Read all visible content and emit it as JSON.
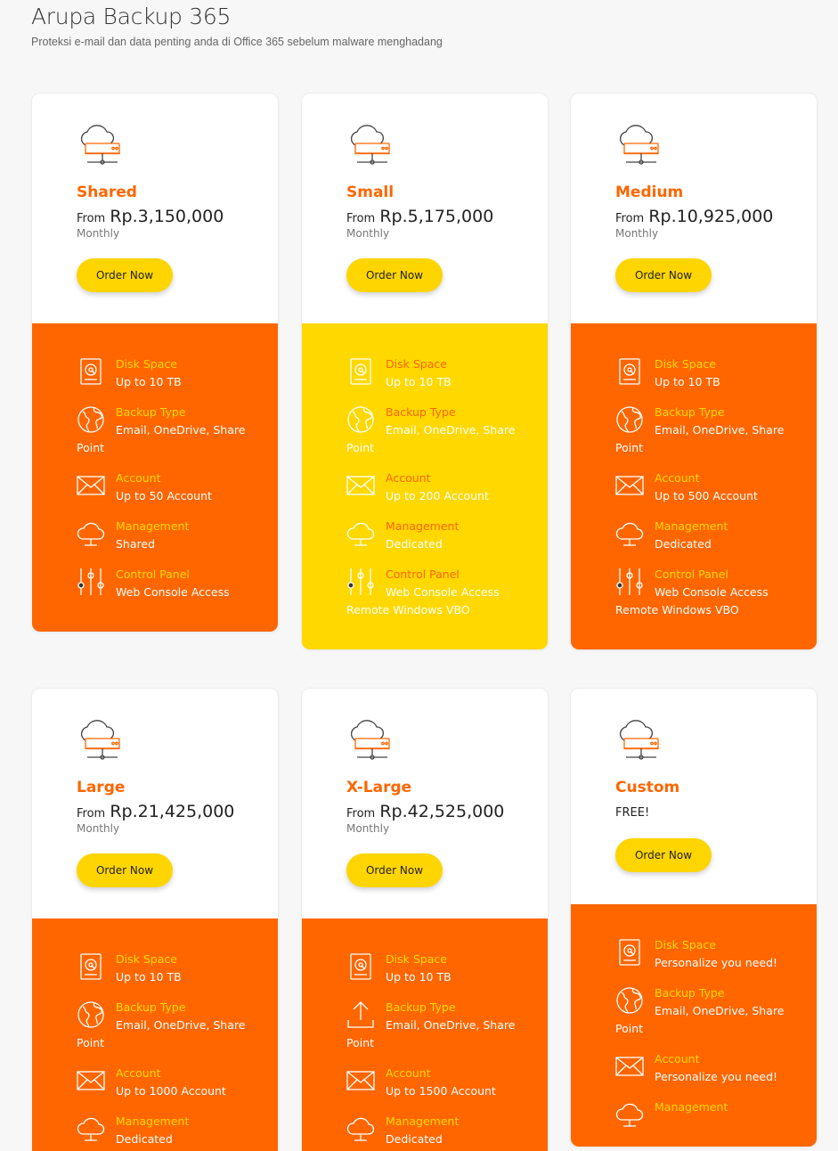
{
  "header": {
    "title": "Arupa Backup 365",
    "subtitle": "Proteksi e-mail dan data penting anda di Office 365 sebelum malware menghadang"
  },
  "colors": {
    "accent": "#ff6600",
    "highlight": "#ffd800",
    "button": "#ffd500"
  },
  "plans": [
    {
      "name": "Shared",
      "from": "From",
      "price": "Rp.3,150,000",
      "period": "Monthly",
      "order": "Order Now",
      "features": [
        {
          "icon": "disk-icon",
          "label": "Disk Space",
          "value": "Up to 10 TB"
        },
        {
          "icon": "globe-icon",
          "label": "Backup Type",
          "value": "Email, OneDrive, Share Point"
        },
        {
          "icon": "envelope-icon",
          "label": "Account",
          "value": "Up to 50 Account"
        },
        {
          "icon": "cloud-icon",
          "label": "Management",
          "value": "Shared"
        },
        {
          "icon": "sliders-icon",
          "label": "Control Panel",
          "value": "Web Console Access"
        }
      ]
    },
    {
      "name": "Small",
      "from": "From",
      "price": "Rp.5,175,000",
      "period": "Monthly",
      "order": "Order Now",
      "features": [
        {
          "icon": "disk-icon",
          "label": "Disk Space",
          "value": "Up to 10 TB"
        },
        {
          "icon": "globe-icon",
          "label": "Backup Type",
          "value": "Email, OneDrive, Share Point"
        },
        {
          "icon": "envelope-icon",
          "label": "Account",
          "value": "Up to 200 Account"
        },
        {
          "icon": "cloud-icon",
          "label": "Management",
          "value": "Dedicated"
        },
        {
          "icon": "sliders-icon",
          "label": "Control Panel",
          "value": "Web Console Access Remote Windows VBO"
        }
      ]
    },
    {
      "name": "Medium",
      "from": "From",
      "price": "Rp.10,925,000",
      "period": "Monthly",
      "order": "Order Now",
      "features": [
        {
          "icon": "disk-icon",
          "label": "Disk Space",
          "value": "Up to 10 TB"
        },
        {
          "icon": "globe-icon",
          "label": "Backup Type",
          "value": "Email, OneDrive, Share Point"
        },
        {
          "icon": "envelope-icon",
          "label": "Account",
          "value": "Up to 500 Account"
        },
        {
          "icon": "cloud-icon",
          "label": "Management",
          "value": "Dedicated"
        },
        {
          "icon": "sliders-icon",
          "label": "Control Panel",
          "value": "Web Console Access Remote Windows VBO"
        }
      ]
    },
    {
      "name": "Large",
      "from": "From",
      "price": "Rp.21,425,000",
      "period": "Monthly",
      "order": "Order Now",
      "features": [
        {
          "icon": "disk-icon",
          "label": "Disk Space",
          "value": "Up to 10 TB"
        },
        {
          "icon": "globe-icon",
          "label": "Backup Type",
          "value": "Email, OneDrive, Share Point"
        },
        {
          "icon": "envelope-icon",
          "label": "Account",
          "value": "Up to 1000 Account"
        },
        {
          "icon": "cloud-icon",
          "label": "Management",
          "value": "Dedicated"
        }
      ]
    },
    {
      "name": "X-Large",
      "from": "From",
      "price": "Rp.42,525,000",
      "period": "Monthly",
      "order": "Order Now",
      "features": [
        {
          "icon": "disk-icon",
          "label": "Disk Space",
          "value": "Up to 10 TB"
        },
        {
          "icon": "upload-icon",
          "label": "Backup Type",
          "value": "Email, OneDrive, Share Point"
        },
        {
          "icon": "envelope-icon",
          "label": "Account",
          "value": "Up to 1500 Account"
        },
        {
          "icon": "cloud-icon",
          "label": "Management",
          "value": "Dedicated"
        }
      ]
    },
    {
      "name": "Custom",
      "free": "FREE!",
      "order": "Order Now",
      "features": [
        {
          "icon": "disk-icon",
          "label": "Disk Space",
          "value": "Personalize you need!"
        },
        {
          "icon": "globe-icon",
          "label": "Backup Type",
          "value": "Email, OneDrive, Share Point"
        },
        {
          "icon": "envelope-icon",
          "label": "Account",
          "value": "Personalize you need!"
        },
        {
          "icon": "cloud-icon",
          "label": "Management",
          "value": ""
        }
      ]
    }
  ]
}
